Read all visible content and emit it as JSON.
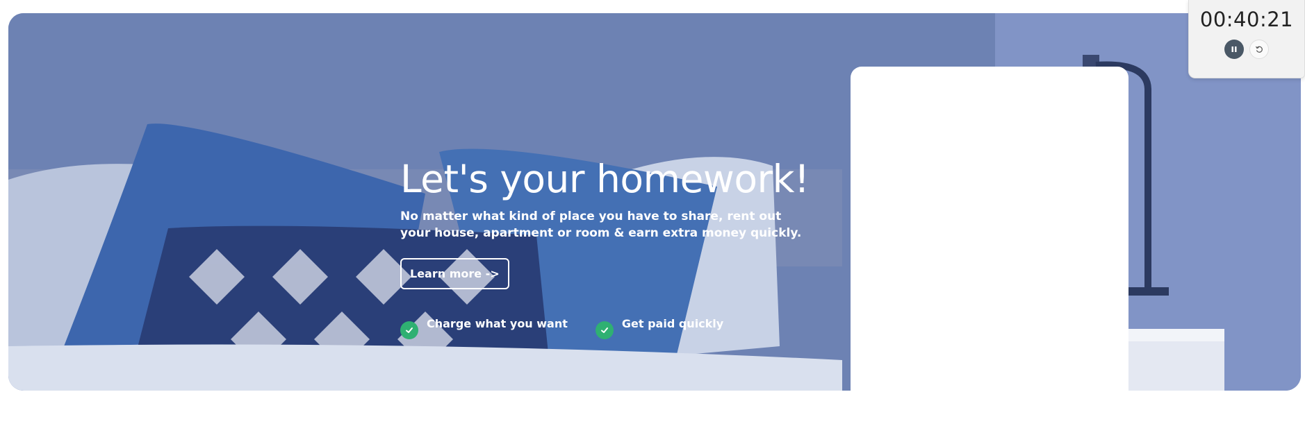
{
  "hero": {
    "title": "Let's your homework!",
    "subtitle": "No matter what kind of place you have to share, rent out your house, apartment or room & earn extra money quickly.",
    "cta_label": "Learn more ->",
    "features": [
      {
        "label": "Charge what you want",
        "icon": "check-icon"
      },
      {
        "label": "Get paid quickly",
        "icon": "check-icon"
      }
    ]
  },
  "timer": {
    "time": "00:40:21",
    "pause_icon": "pause-icon",
    "reset_icon": "reset-icon"
  },
  "colors": {
    "overlay": "#6a7fb0",
    "check": "#2fb072",
    "pause_button": "#4a5866"
  }
}
